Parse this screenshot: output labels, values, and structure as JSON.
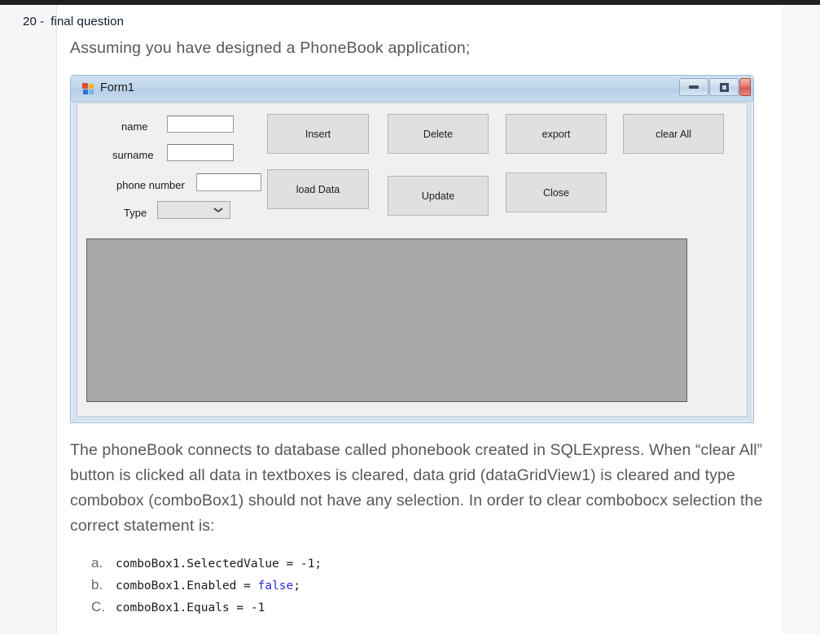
{
  "header": {
    "number": "20 -",
    "title": "final question"
  },
  "intro": "Assuming you have designed a PhoneBook application;",
  "form": {
    "title": "Form1",
    "icon": "winforms-icon",
    "window_buttons": {
      "minimize": "minimize-icon",
      "maximize": "maximize-icon",
      "close": "close-icon"
    },
    "fields": [
      {
        "label": "name",
        "value": "",
        "placeholder": ""
      },
      {
        "label": "surname",
        "value": "",
        "placeholder": ""
      },
      {
        "label": "phone number",
        "value": "",
        "placeholder": ""
      },
      {
        "label": "Type",
        "value": "",
        "placeholder": ""
      }
    ],
    "buttons_row1": [
      {
        "label": "Insert"
      },
      {
        "label": "Delete"
      },
      {
        "label": "export"
      },
      {
        "label": "clear All"
      }
    ],
    "buttons_row2": [
      {
        "label": "load Data"
      },
      {
        "label": "Update"
      },
      {
        "label": "Close"
      }
    ],
    "datagrid": {
      "name": "dataGridView1",
      "rows": [],
      "columns": []
    }
  },
  "paragraph": "The phoneBook connects to database called phonebook created in SQLExpress. When “clear All” button is clicked all data in textboxes is cleared, data grid (dataGridView1) is cleared and type combobox (comboBox1) should not have any selection. In order to clear combobocx selection the correct statement is:",
  "options": [
    {
      "marker": "a.",
      "code_before": "comboBox1.SelectedValue = -1;",
      "keyword": "",
      "code_after": ""
    },
    {
      "marker": "b.",
      "code_before": "comboBox1.Enabled = ",
      "keyword": "false",
      "code_after": ";"
    },
    {
      "marker": "C.",
      "code_before": "comboBox1.Equals = -1",
      "keyword": "",
      "code_after": ""
    }
  ],
  "colors": {
    "keyword_blue": "#2b2bd6",
    "body_text": "#58585a",
    "header_text": "#101a2e",
    "titlebar": "#b4cde6",
    "datagrid_fill": "#a8a8a8"
  }
}
